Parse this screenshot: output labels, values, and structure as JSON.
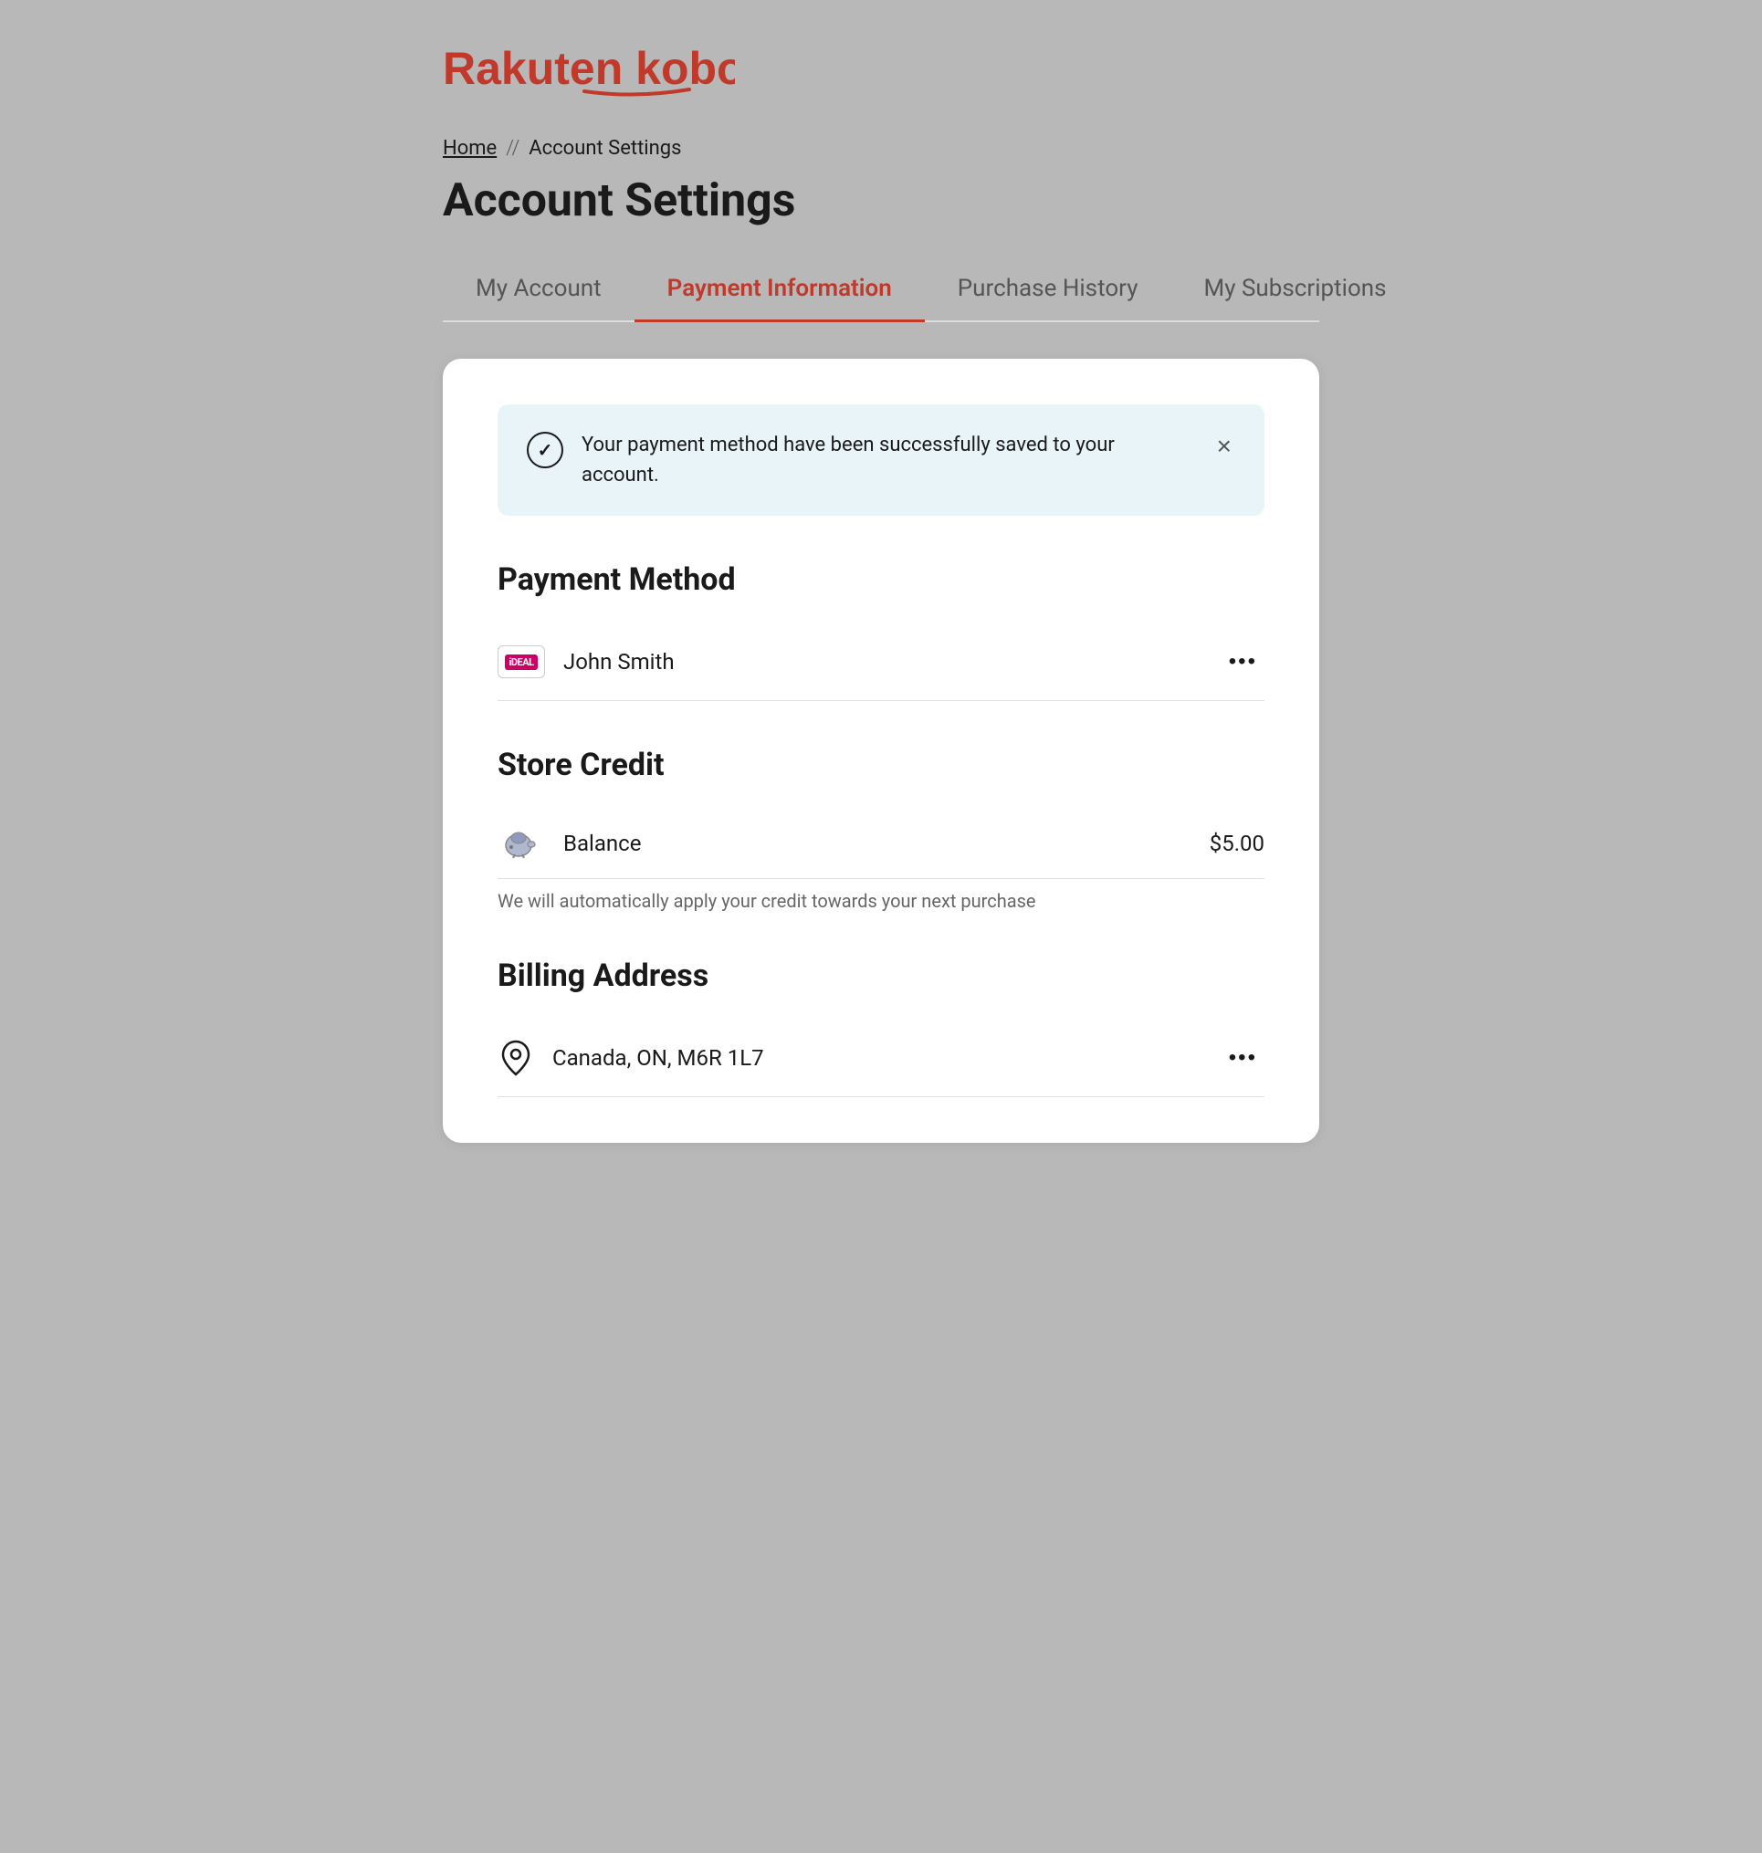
{
  "logo": {
    "text": "Rakuten kobo"
  },
  "breadcrumb": {
    "home_label": "Home",
    "separator": "//",
    "current_label": "Account Settings"
  },
  "page_title": "Account Settings",
  "tabs": [
    {
      "id": "my-account",
      "label": "My Account",
      "active": false
    },
    {
      "id": "payment-information",
      "label": "Payment Information",
      "active": true
    },
    {
      "id": "purchase-history",
      "label": "Purchase History",
      "active": false
    },
    {
      "id": "my-subscriptions",
      "label": "My Subscriptions",
      "active": false
    }
  ],
  "success_notification": {
    "message": "Your payment method have been successfully saved to your account.",
    "close_label": "×"
  },
  "payment_method": {
    "heading": "Payment Method",
    "items": [
      {
        "icon_label": "iDEAL",
        "name": "John Smith",
        "more_options_label": "•••"
      }
    ]
  },
  "store_credit": {
    "heading": "Store Credit",
    "balance_label": "Balance",
    "balance_amount": "$5.00",
    "note": "We will automatically apply your credit towards your next purchase"
  },
  "billing_address": {
    "heading": "Billing Address",
    "items": [
      {
        "address": "Canada, ON, M6R 1L7",
        "more_options_label": "•••"
      }
    ]
  }
}
